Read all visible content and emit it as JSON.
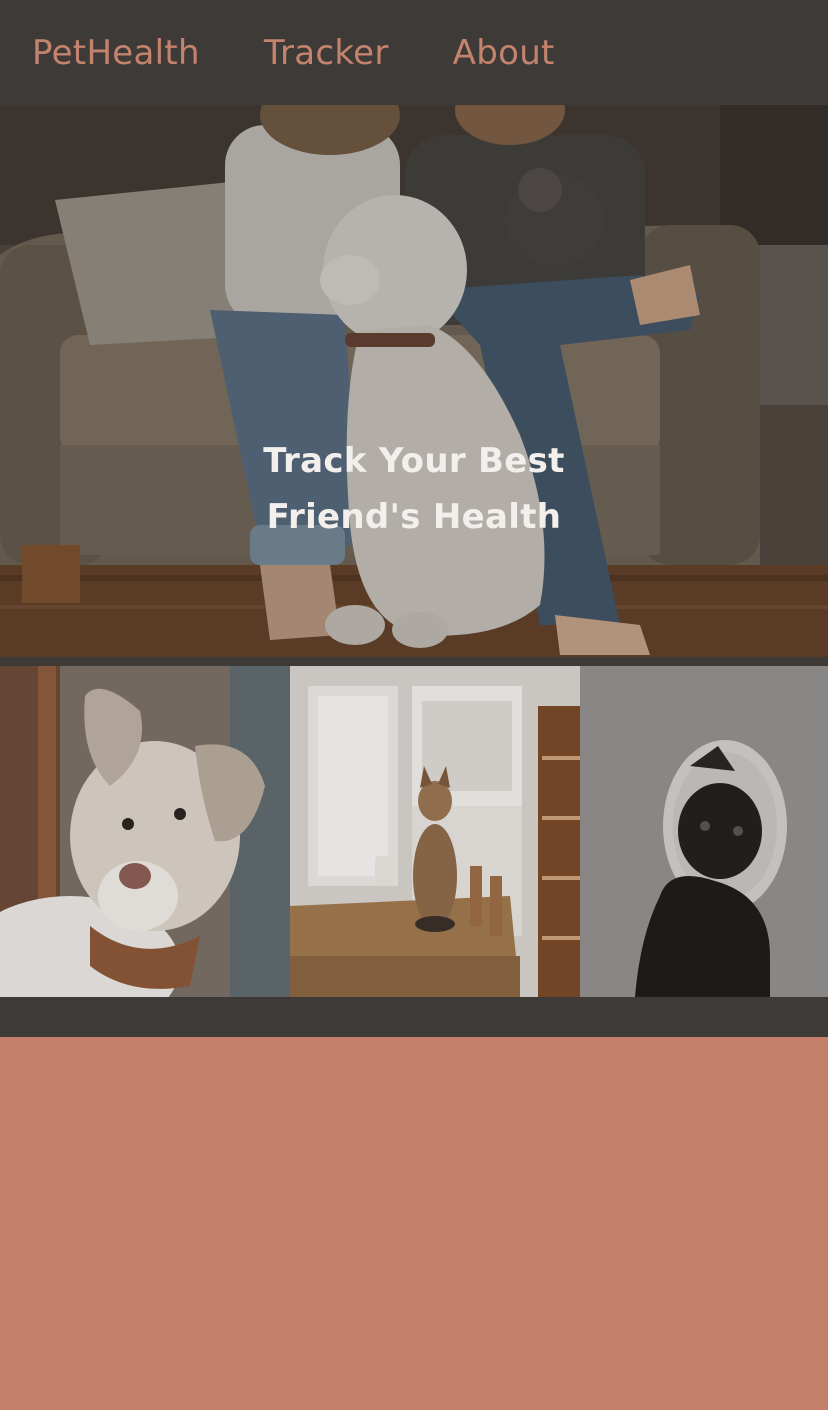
{
  "nav": {
    "brand": "PetHealth",
    "links": [
      {
        "label": "Tracker"
      },
      {
        "label": "About"
      }
    ]
  },
  "hero": {
    "title_line1": "Track Your Best",
    "title_line2": "Friend's Health"
  },
  "colors": {
    "nav_bg": "#3e3a38",
    "accent": "#c4836d",
    "footer_bg": "#c47f6a",
    "hero_text": "#f2efec"
  }
}
